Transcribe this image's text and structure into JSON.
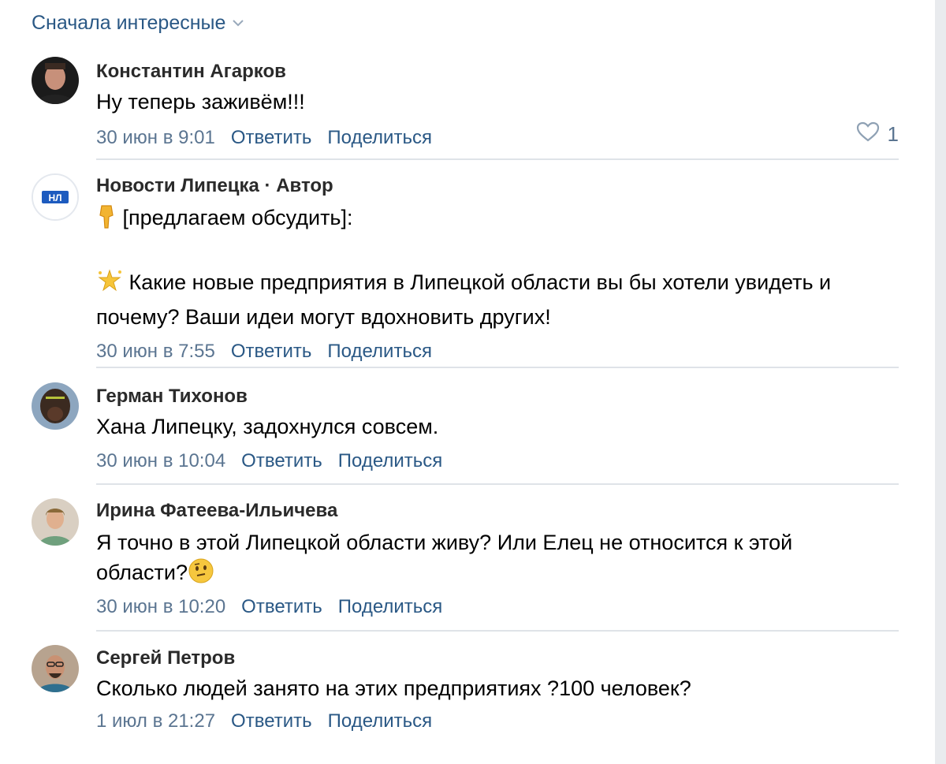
{
  "sort": {
    "label": "Сначала интересные",
    "icon": "chevron-down-icon"
  },
  "comments": [
    {
      "author": "Константин Агарков",
      "text": "Ну теперь заживём!!!",
      "date": "30 июн в 9:01",
      "reply": "Ответить",
      "share": "Поделиться",
      "likes": "1"
    },
    {
      "author": "Новости Липецка",
      "author_tag": "Автор",
      "avatar_text": "НЛ",
      "line1": "[предлагаем обсудить]:",
      "line2": "Какие новые предприятия в Липецкой области вы бы хотели увидеть и",
      "line3": "почему? Ваши идеи могут вдохновить других!",
      "date": "30 июн в 7:55",
      "reply": "Ответить",
      "share": "Поделиться"
    },
    {
      "author": "Герман Тихонов",
      "text": "Хана Липецку, задохнулся совсем.",
      "date": "30 июн в 10:04",
      "reply": "Ответить",
      "share": "Поделиться"
    },
    {
      "author": "Ирина Фатеева-Ильичева",
      "line1": "Я точно в этой Липецкой области живу? Или Елец не относится к этой",
      "line2": "области?",
      "date": "30 июн в 10:20",
      "reply": "Ответить",
      "share": "Поделиться"
    },
    {
      "author": "Сергей Петров",
      "text": "Сколько людей занято на этих предприятиях ?100 человек?",
      "date": "1 июл в 21:27",
      "reply": "Ответить",
      "share": "Поделиться"
    }
  ],
  "colors": {
    "link": "#2a5885",
    "meta": "#5b7591",
    "divider": "#dfe3e8"
  }
}
